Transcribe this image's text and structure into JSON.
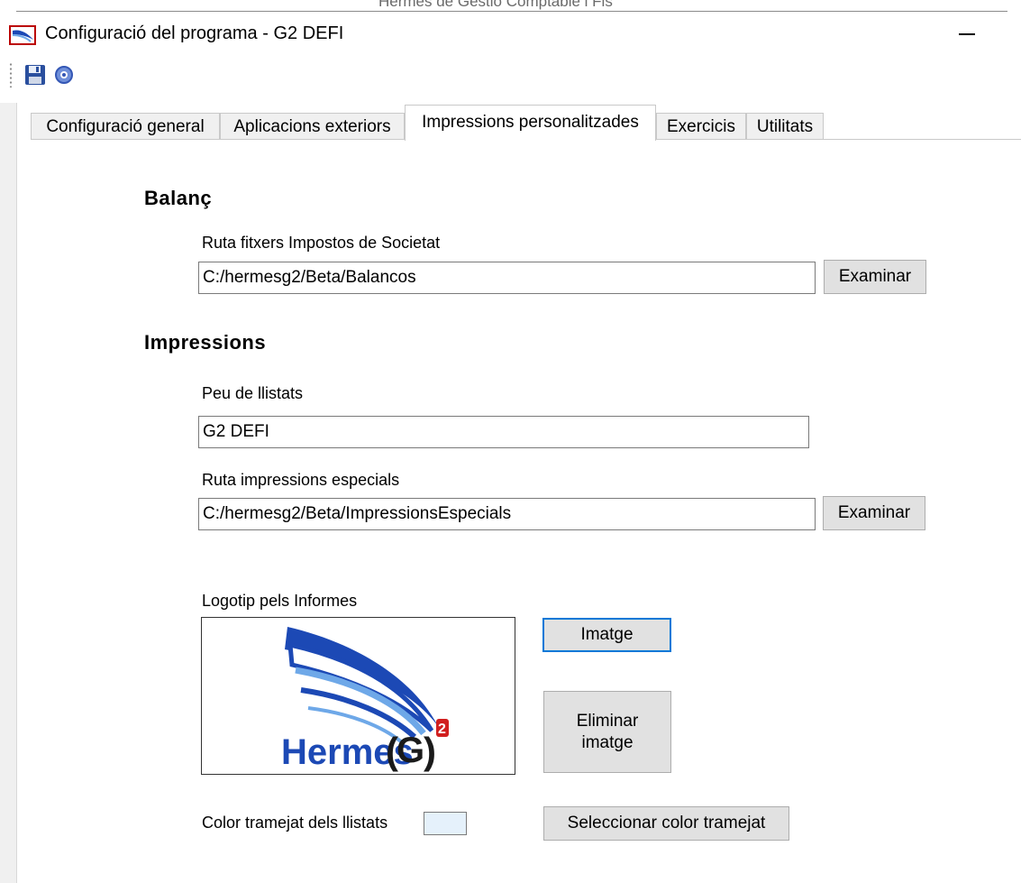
{
  "window": {
    "title": "Configuració del programa - G2 DEFI",
    "background_window_title": "Hermes de Gestió Comptable i Fis",
    "minimize_symbol": "—"
  },
  "toolbar": {
    "save_icon": "floppy-disk-icon",
    "help_icon": "help-icon"
  },
  "tabs": [
    {
      "label": "Configuració general",
      "active": false
    },
    {
      "label": "Aplicacions exteriors",
      "active": false
    },
    {
      "label": "Impressions personalitzades",
      "active": true
    },
    {
      "label": "Exercicis",
      "active": false
    },
    {
      "label": "Utilitats",
      "active": false
    }
  ],
  "balance": {
    "heading": "Balanç",
    "path_label": "Ruta fitxers Impostos de Societat",
    "path_value": "C:/hermesg2/Beta/Balancos",
    "browse_label": "Examinar"
  },
  "prints": {
    "heading": "Impressions",
    "footer_label": "Peu de llistats",
    "footer_value": "G2 DEFI",
    "special_path_label": "Ruta impressions especials",
    "special_path_value": "C:/hermesg2/Beta/ImpressionsEspecials",
    "browse_label": "Examinar"
  },
  "logo": {
    "label": "Logotip pels Informes",
    "logo_text": "Hermes",
    "logo_badge": "G",
    "logo_superscript": "2",
    "image_button": "Imatge",
    "delete_button_line1": "Eliminar",
    "delete_button_line2": "imatge"
  },
  "striping": {
    "label": "Color tramejat dels llistats",
    "swatch_color": "#e5f1fb",
    "select_button": "Seleccionar color tramejat"
  },
  "colors": {
    "accent": "#0078d7",
    "logo_blue": "#1c49b5",
    "logo_light_blue": "#6ea8e8"
  }
}
